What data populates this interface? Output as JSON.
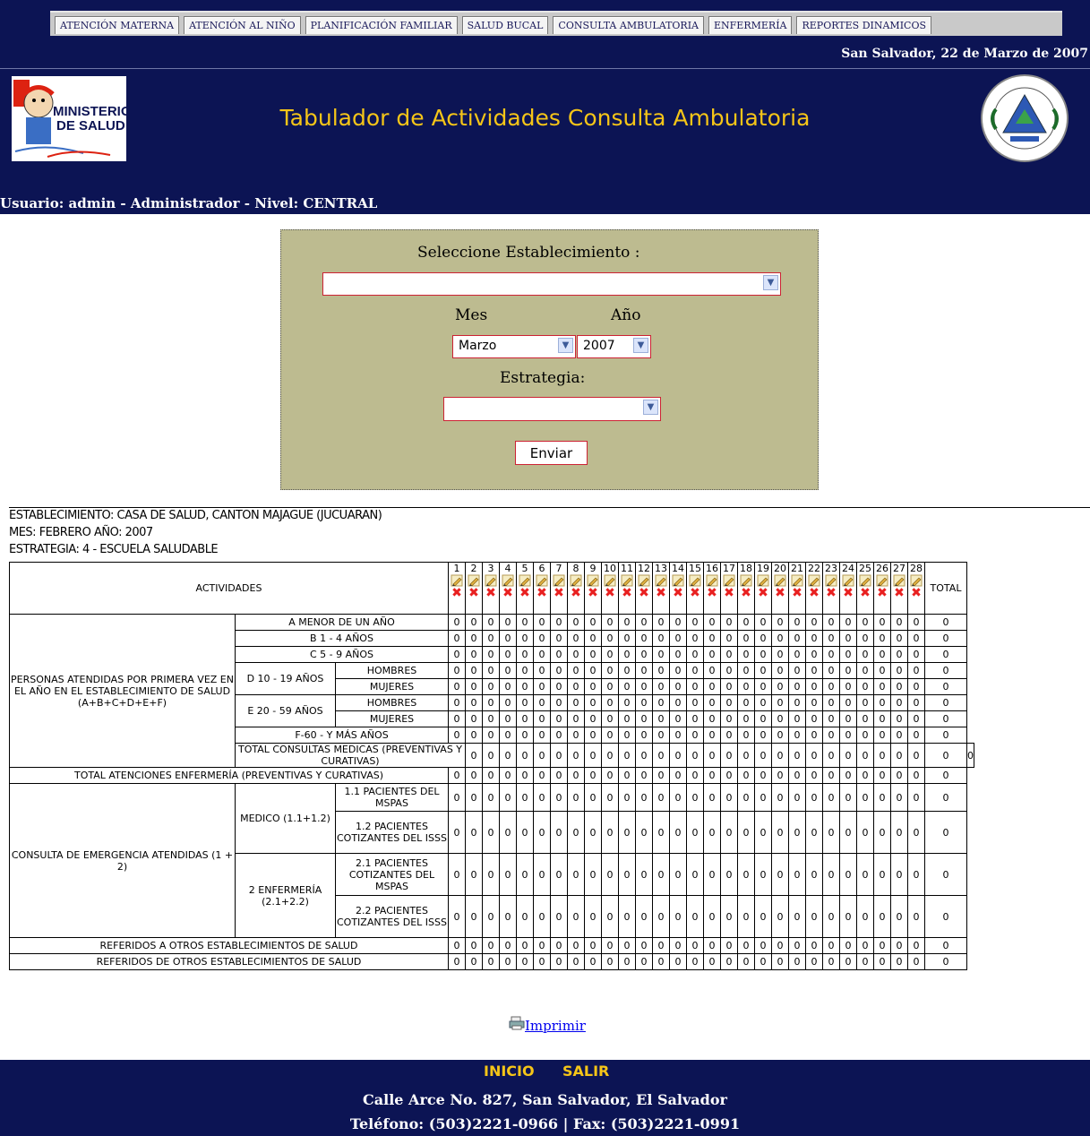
{
  "nav": {
    "tabs": [
      "ATENCIÓN MATERNA",
      "ATENCIÓN AL NIÑO",
      "PLANIFICACIÓN FAMILIAR",
      "SALUD BUCAL",
      "CONSULTA AMBULATORIA",
      "ENFERMERÍA",
      "REPORTES DINAMICOS"
    ],
    "date": "San Salvador, 22 de Marzo de 2007"
  },
  "header": {
    "title": "Tabulador de Actividades Consulta Ambulatoria",
    "logo_text": "MINISTERIO DE SALUD"
  },
  "user": {
    "line": "Usuario: admin - Administrador - Nivel: CENTRAL"
  },
  "form": {
    "establecimiento_label": "Seleccione Establecimiento :",
    "establecimiento_value": "",
    "mes_label": "Mes",
    "anio_label": "Año",
    "mes_value": "Marzo",
    "anio_value": "2007",
    "estrategia_label": "Estrategia:",
    "estrategia_value": "",
    "submit_label": "Enviar"
  },
  "info": {
    "establecimiento": "ESTABLECIMIENTO: CASA DE SALUD, CANTON MAJAGUE (JUCUARAN)",
    "mes": "MES: FEBRERO AÑO: 2007",
    "estrategia": "ESTRATEGIA: 4 - ESCUELA SALUDABLE"
  },
  "table": {
    "actividades_header": "ACTIVIDADES",
    "total_header": "TOTAL",
    "days": [
      "1",
      "2",
      "3",
      "4",
      "5",
      "6",
      "7",
      "8",
      "9",
      "10",
      "11",
      "12",
      "13",
      "14",
      "15",
      "16",
      "17",
      "18",
      "19",
      "20",
      "21",
      "22",
      "23",
      "24",
      "25",
      "26",
      "27",
      "28"
    ],
    "group1": "PERSONAS ATENDIDAS POR PRIMERA VEZ EN EL AÑO EN EL ESTABLECIMIENTO DE SALUD (A+B+C+D+E+F)",
    "rowA": "A MENOR DE UN AÑO",
    "rowB": "B 1 - 4 AÑOS",
    "rowC": "C 5 - 9 AÑOS",
    "rowD": "D 10 - 19 AÑOS",
    "rowE": "E 20 - 59 AÑOS",
    "hombres": "HOMBRES",
    "mujeres": "MUJERES",
    "rowF": "F-60 - Y MÁS AÑOS",
    "total_medicas": "TOTAL CONSULTAS MEDICAS (PREVENTIVAS Y CURATIVAS)",
    "total_enfermeria": "TOTAL ATENCIONES ENFERMERÍA (PREVENTIVAS Y CURATIVAS)",
    "group2": "CONSULTA DE EMERGENCIA ATENDIDAS (1 + 2)",
    "medico": "MEDICO (1.1+1.2)",
    "enfermeria": "2 ENFERMERÍA (2.1+2.2)",
    "r11": "1.1 PACIENTES DEL MSPAS",
    "r12": "1.2 PACIENTES COTIZANTES DEL ISSS",
    "r21": "2.1 PACIENTES COTIZANTES DEL MSPAS",
    "r22": "2.2 PACIENTES COTIZANTES DEL ISSS",
    "referidos_a": "REFERIDOS A OTROS ESTABLECIMIENTOS DE SALUD",
    "referidos_de": "REFERIDOS DE OTROS ESTABLECIMIENTOS DE SALUD",
    "cell_value": "0",
    "total_value": "0"
  },
  "print_label": "Imprimir",
  "footer": {
    "inicio": "INICIO",
    "salir": "SALIR",
    "address": "Calle Arce No. 827, San Salvador, El Salvador",
    "phone": "Teléfono: (503)2221-0966 | Fax: (503)2221-0991"
  },
  "colors": {
    "navy": "#0c1454",
    "title_yellow": "#f5c518",
    "panel": "#bdbb90",
    "delete_red": "#e82020"
  }
}
